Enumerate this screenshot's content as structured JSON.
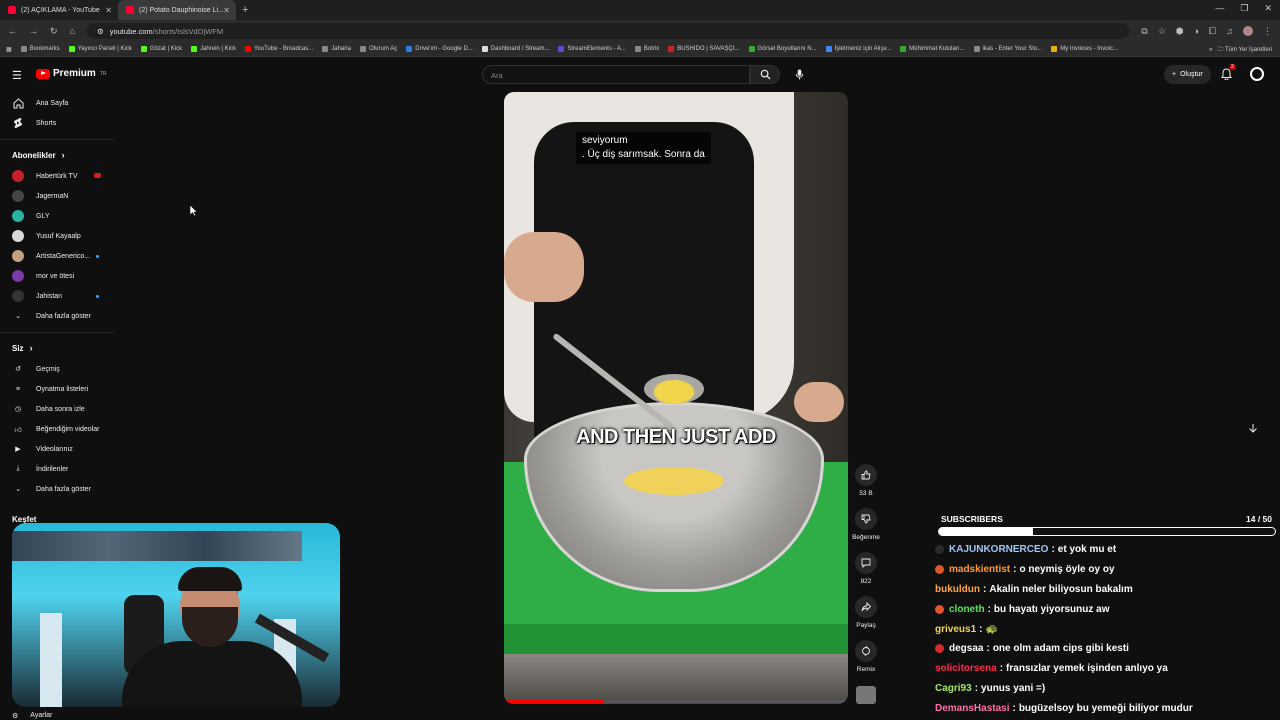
{
  "browser": {
    "tabs": [
      {
        "label": "(2) AÇIKLAMA - YouTube",
        "active": false
      },
      {
        "label": "(2) Potato Dauphinoise Li...",
        "active": true
      }
    ],
    "url_host": "youtube.com",
    "url_path": "/shorts/tslsVdOjWFM",
    "bookmarks": [
      "Bookmarks",
      "Yayıncı Paneli | Kick",
      "Gözat | Kick",
      "Jahrein | Kick",
      "YouTube - Broadcas...",
      "Jaharia",
      "Oturum Aç",
      "Drive'ım - Google D...",
      "Dashboard / Stream...",
      "StreamElements - A...",
      "Botrix",
      "BUSHIDO | SAVAŞÇI...",
      "Görsel Boyutlarını N...",
      "İşletmeniz için Alışv...",
      "Mühimmat Kutuları...",
      "ikas - Enter Your Sto...",
      "My Invoices - Invoic..."
    ],
    "bookmarks_right": "Tüm Yer İşaretleri"
  },
  "youtube": {
    "logo_text": "Premium",
    "logo_sup": "TR",
    "search_placeholder": "Ara",
    "create_label": "Oluştur",
    "notif_count": "2"
  },
  "sidebar": {
    "main": [
      {
        "label": "Ana Sayfa",
        "icon": "home-icon"
      },
      {
        "label": "Shorts",
        "icon": "shorts-icon"
      }
    ],
    "subs_title": "Abonelikler",
    "subscriptions": [
      {
        "label": "Habertürk TV",
        "color": "#c8202a",
        "live": true
      },
      {
        "label": "JagermaN",
        "color": "#444444",
        "dot": false
      },
      {
        "label": "GLY",
        "color": "#2ab3a0",
        "dot": false
      },
      {
        "label": "Yusuf Kayaalp",
        "color": "#d8d8d8",
        "dot": false
      },
      {
        "label": "ArtistaGenerico...",
        "color": "#c2a083",
        "dot": true
      },
      {
        "label": "mor ve ötesi",
        "color": "#7a3aa8",
        "dot": false
      },
      {
        "label": "Jahistan",
        "color": "#333333",
        "dot": true
      }
    ],
    "more_subs": "Daha fazla göster",
    "you_title": "Siz",
    "you_items": [
      {
        "label": "Geçmiş",
        "icon": "history-icon"
      },
      {
        "label": "Oynatma listeleri",
        "icon": "playlist-icon"
      },
      {
        "label": "Daha sonra izle",
        "icon": "clock-icon"
      },
      {
        "label": "Beğendiğim videolar",
        "icon": "like-icon"
      },
      {
        "label": "Videolarınız",
        "icon": "video-icon"
      },
      {
        "label": "İndirilenler",
        "icon": "download-icon"
      }
    ],
    "more_you": "Daha fazla göster",
    "explore_title": "Keşfet",
    "settings": "Ayarlar"
  },
  "video": {
    "subtitle_line1": "seviyorum",
    "subtitle_line2": ". Üç diş sarımsak.  Sonra da",
    "caption": "AND THEN JUST ADD",
    "progress": 0.29
  },
  "actions": {
    "likes": "53 B",
    "dislike": "Beğenme",
    "comments": "822",
    "share": "Paylaş",
    "remix": "Remix"
  },
  "overlay": {
    "subs_label": "SUBSCRIBERS",
    "subs_count": "14 / 50",
    "subs_progress": 0.28,
    "chat": [
      {
        "user": "KAJUNKORNERCEO",
        "color": "#9cc7f7",
        "text": "et yok mu et",
        "badge": "#2a2a2a"
      },
      {
        "user": "madskientist",
        "color": "#ff9a2e",
        "text": "o neymiş öyle oy oy",
        "badge": "#e0552a"
      },
      {
        "user": "bukuldun",
        "color": "#ffa640",
        "text": "Akalin neler biliyosun bakalım",
        "badge": ""
      },
      {
        "user": "cloneth",
        "color": "#59e35a",
        "text": "bu hayatı yiyorsunuz aw",
        "badge": "#e0552a"
      },
      {
        "user": "griveus1",
        "color": "#f2d64b",
        "text": "🐢",
        "badge": ""
      },
      {
        "user": "degsaa",
        "color": "#ffffff",
        "text": "one olm adam cips gibi kesti",
        "badge": "#d22b2b"
      },
      {
        "user": "solicitorsena",
        "color": "#ff2a4a",
        "text": "fransızlar yemek işinden anlıyo ya",
        "badge": ""
      },
      {
        "user": "Cagri93",
        "color": "#a7e36b",
        "text": "yunus yani =)",
        "badge": ""
      },
      {
        "user": "DemansHastasi",
        "color": "#ff6fa8",
        "text": "bugüzelsoy bu yemeği biliyor mudur",
        "badge": ""
      }
    ]
  }
}
